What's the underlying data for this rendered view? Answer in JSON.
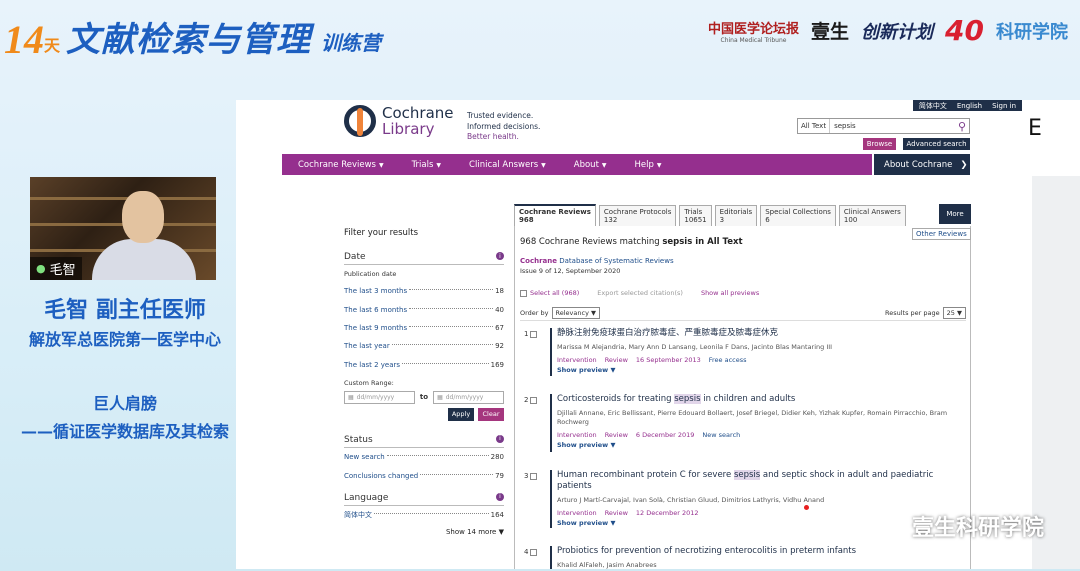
{
  "banner": {
    "days_num": "14",
    "days_unit": "天",
    "title": "文献检索与管理",
    "subtitle": "训练营",
    "logos": {
      "cmt_zh": "中国医学论坛报",
      "cmt_en": "China Medical Tribune",
      "yisheng": "壹生",
      "chuangyi": "创新计划",
      "forty": "40",
      "keyan": "科研学院"
    }
  },
  "speaker": {
    "name_tag": "毛智",
    "name_title": "毛智 副主任医师",
    "org": "解放军总医院第一医学中心",
    "talk_line1": "巨人肩膀",
    "talk_line2": "——循证医学数据库及其检索"
  },
  "browser": {
    "top_links": [
      "简体中文",
      "English",
      "Sign in"
    ],
    "side_glyph": "E",
    "logo_line1": "Cochrane",
    "logo_line2": "Library",
    "tagline": [
      "Trusted evidence.",
      "Informed decisions.",
      "Better health."
    ],
    "search": {
      "scope": "All Text",
      "value": "sepsis"
    },
    "browse_label": "Browse",
    "advanced_label": "Advanced search",
    "nav": [
      "Cochrane Reviews",
      "Trials",
      "Clinical Answers",
      "About",
      "Help"
    ],
    "about_cochrane": "About Cochrane",
    "filters": {
      "title": "Filter your results",
      "date_head": "Date",
      "pub_date": "Publication date",
      "date_rows": [
        {
          "label": "The last 3 months",
          "count": "18"
        },
        {
          "label": "The last 6 months",
          "count": "40"
        },
        {
          "label": "The last 9 months",
          "count": "67"
        },
        {
          "label": "The last year",
          "count": "92"
        },
        {
          "label": "The last 2 years",
          "count": "169"
        }
      ],
      "custom_range": "Custom Range:",
      "date_placeholder": "dd/mm/yyyy",
      "to": "to",
      "apply": "Apply",
      "clear": "Clear",
      "status_head": "Status",
      "status_rows": [
        {
          "label": "New search",
          "count": "280"
        },
        {
          "label": "Conclusions changed",
          "count": "79"
        }
      ],
      "language_head": "Language",
      "language_rows": [
        {
          "label": "简体中文",
          "count": "164"
        }
      ],
      "show_more": "Show 14 more"
    },
    "tabs": [
      {
        "label": "Cochrane Reviews",
        "count": "968"
      },
      {
        "label": "Cochrane Protocols",
        "count": "132"
      },
      {
        "label": "Trials",
        "count": "10651"
      },
      {
        "label": "Editorials",
        "count": "3"
      },
      {
        "label": "Special Collections",
        "count": "6"
      },
      {
        "label": "Clinical Answers",
        "count": "100"
      }
    ],
    "more_label": "More",
    "other_reviews": "Other Reviews",
    "results": {
      "heading_pre": "968 Cochrane Reviews matching ",
      "heading_term": "sepsis in All Text",
      "db_pre": "Cochrane",
      "db_name": "Database of Systematic Reviews",
      "issue": "Issue 9 of 12, September 2020",
      "select_all": "Select all (968)",
      "export": "Export selected citation(s)",
      "show_all_previews": "Show all previews",
      "order_by": "Order by",
      "order_value": "Relevancy",
      "per_page_label": "Results per page",
      "per_page_value": "25",
      "items": [
        {
          "num": "1",
          "title_pre": "静脉注射免疫球蛋白治疗脓毒症、严重脓毒症及脓毒症休克",
          "title_hl": "",
          "title_post": "",
          "authors": "Marissa M Alejandria, Mary Ann D Lansang, Leonila F Dans, Jacinto Blas Mantaring III",
          "type": "Intervention",
          "stage": "Review",
          "date": "16 September 2013",
          "extra": "Free access",
          "preview": "Show preview"
        },
        {
          "num": "2",
          "title_pre": "Corticosteroids for treating ",
          "title_hl": "sepsis",
          "title_post": " in children and adults",
          "authors": "Djillali Annane, Eric Bellissant, Pierre Edouard Bollaert, Josef Briegel, Didier Keh, Yizhak Kupfer, Romain Pirracchio, Bram Rochwerg",
          "type": "Intervention",
          "stage": "Review",
          "date": "6 December 2019",
          "extra": "New search",
          "preview": "Show preview"
        },
        {
          "num": "3",
          "title_pre": "Human recombinant protein C for severe ",
          "title_hl": "sepsis",
          "title_post": " and septic shock in adult and paediatric patients",
          "authors": "Arturo J Martí-Carvajal, Ivan Solà, Christian Gluud, Dimitrios Lathyris, Vidhu Anand",
          "type": "Intervention",
          "stage": "Review",
          "date": "12 December 2012",
          "extra": "",
          "preview": "Show preview"
        },
        {
          "num": "4",
          "title_pre": "Probiotics for prevention of necrotizing enterocolitis in preterm infants",
          "title_hl": "",
          "title_post": "",
          "authors": "Khalid AlFaleh, Jasim Anabrees",
          "type": "",
          "stage": "",
          "date": "",
          "extra": "",
          "preview": ""
        }
      ]
    }
  },
  "watermark": "壹生科研学院"
}
